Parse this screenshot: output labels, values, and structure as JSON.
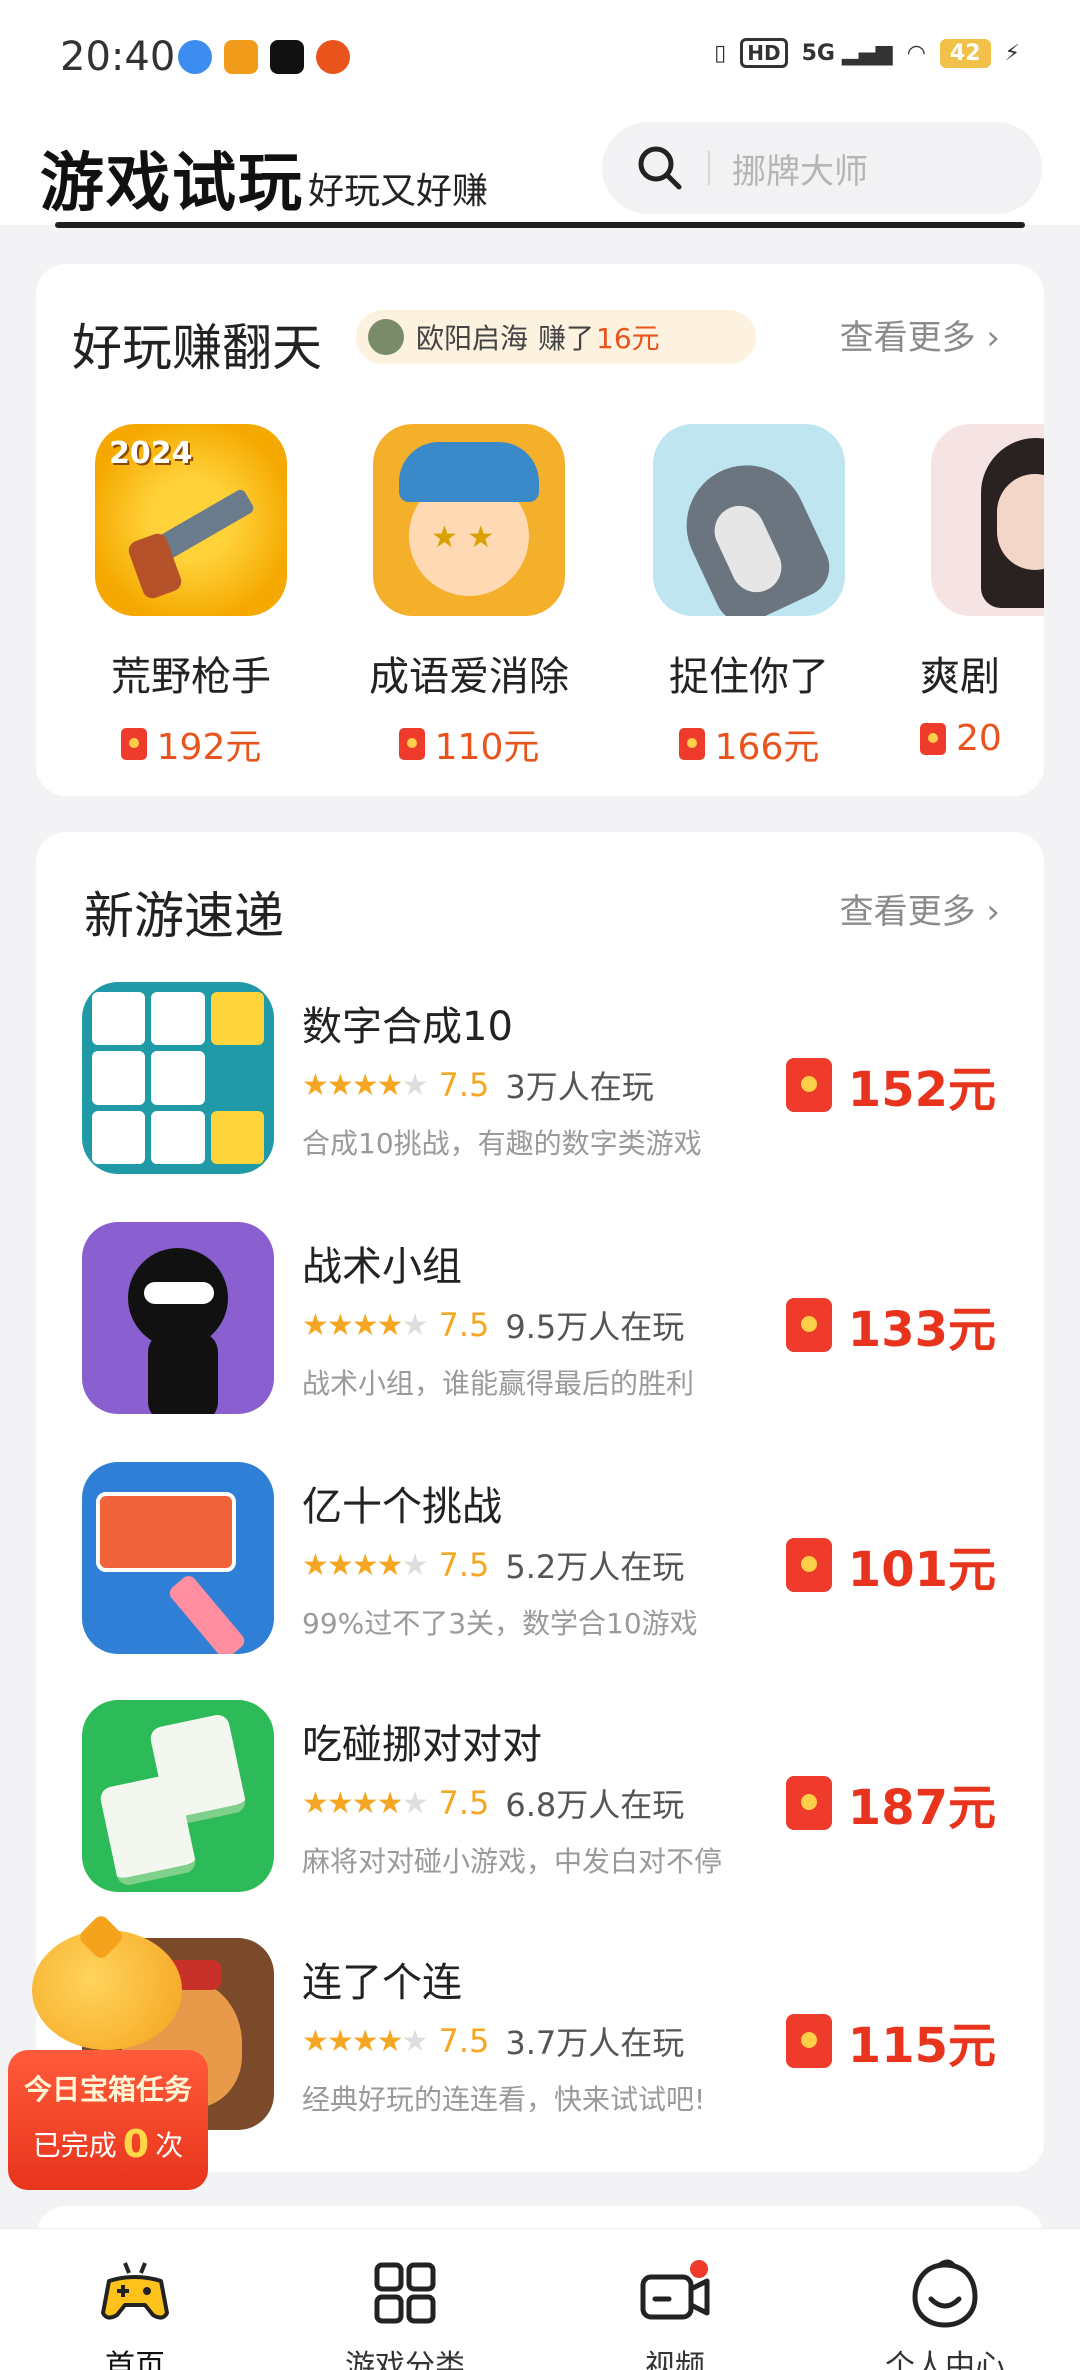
{
  "status_bar": {
    "time": "20:40",
    "network": "5G",
    "hd": "HD",
    "battery": "42"
  },
  "header": {
    "title": "游戏试玩",
    "subtitle": "好玩又好赚",
    "search_placeholder": "挪牌大师"
  },
  "hot_section": {
    "title": "好玩赚翻天",
    "ticker": {
      "user": "欧阳启海",
      "earned_prefix": "赚了",
      "amount": "16元"
    },
    "more": "查看更多 ›",
    "items": [
      {
        "name": "荒野枪手",
        "price": "192元",
        "icon_label": "2024"
      },
      {
        "name": "成语爱消除",
        "price": "110元"
      },
      {
        "name": "捉住你了",
        "price": "166元"
      },
      {
        "name": "爽剧",
        "price": "20"
      }
    ]
  },
  "new_section": {
    "title": "新游速递",
    "more": "查看更多 ›",
    "games": [
      {
        "name": "数字合成10",
        "rating": "7.5",
        "players": "3万人在玩",
        "desc": "合成10挑战，有趣的数字类游戏",
        "reward": "152元"
      },
      {
        "name": "战术小组",
        "rating": "7.5",
        "players": "9.5万人在玩",
        "desc": "战术小组，谁能赢得最后的胜利",
        "reward": "133元"
      },
      {
        "name": "亿十个挑战",
        "rating": "7.5",
        "players": "5.2万人在玩",
        "desc": "99%过不了3关，数学合10游戏",
        "reward": "101元"
      },
      {
        "name": "吃碰挪对对对",
        "rating": "7.5",
        "players": "6.8万人在玩",
        "desc": "麻将对对碰小游戏，中发白对不停",
        "reward": "187元"
      },
      {
        "name": "连了个连",
        "rating": "7.5",
        "players": "3.7万人在玩",
        "desc": "经典好玩的连连看，快来试试吧!",
        "reward": "115元"
      }
    ]
  },
  "treasure": {
    "title": "今日宝箱任务",
    "done_prefix": "已完成",
    "count": "0",
    "suffix": "次"
  },
  "tabs": [
    {
      "label": "首页",
      "icon": "gamepad-icon"
    },
    {
      "label": "游戏分类",
      "icon": "grid-icon"
    },
    {
      "label": "视频",
      "icon": "video-icon"
    },
    {
      "label": "个人中心",
      "icon": "smile-icon"
    }
  ],
  "colors": {
    "accent": "#e8341c",
    "star": "#f5a623",
    "red_packet": "#ef3b2b"
  }
}
